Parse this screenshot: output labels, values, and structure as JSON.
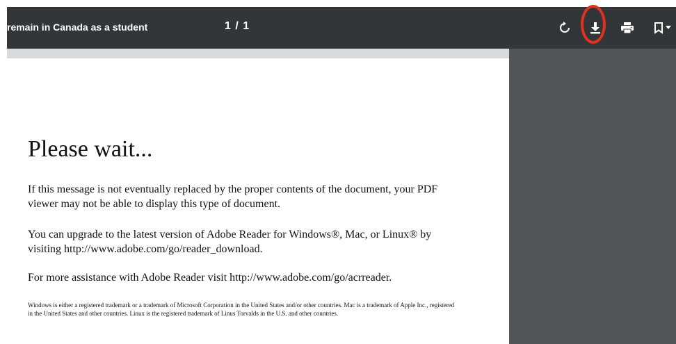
{
  "toolbar": {
    "title": "remain in Canada as a student",
    "page_indicator": "1 / 1",
    "icons": [
      "rotate-icon",
      "download-icon",
      "print-icon",
      "bookmark-icon",
      "chevron-down-icon"
    ],
    "highlight_color": "#e0321f",
    "background_color": "#323639"
  },
  "document": {
    "heading": "Please wait...",
    "paragraph_1": "If this message is not eventually replaced by the proper contents of the document, your PDF viewer may not be able to display this type of document.",
    "paragraph_2": "You can upgrade to the latest version of Adobe Reader for Windows®, Mac, or Linux® by visiting  http://www.adobe.com/go/reader_download.",
    "paragraph_3": "For more assistance with Adobe Reader visit  http://www.adobe.com/go/acrreader.",
    "trademark_notice": "Windows is either a registered trademark or a trademark of Microsoft Corporation in the United States and/or other countries. Mac is a trademark of Apple Inc., registered in the United States and other countries. Linux is the registered trademark of Linus Torvalds in the U.S. and other countries."
  }
}
